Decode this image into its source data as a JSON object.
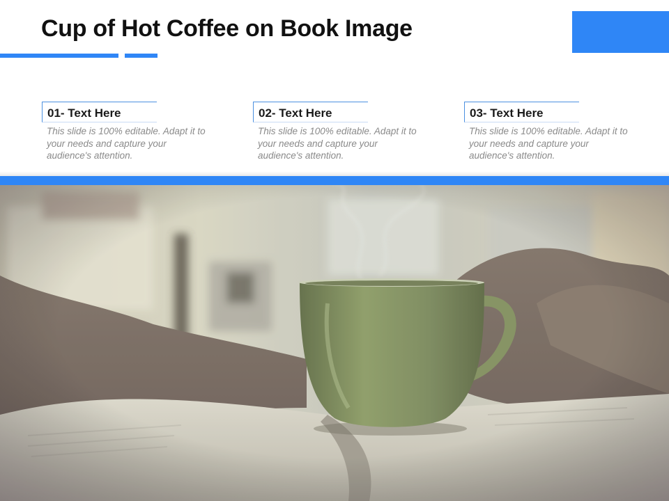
{
  "slide": {
    "title": "Cup of Hot Coffee on Book Image",
    "accent_color": "#2f86f6"
  },
  "cards": [
    {
      "heading": "01- Text Here",
      "description": "This slide is 100% editable. Adapt it to your needs and capture your audience's attention."
    },
    {
      "heading": "02- Text Here",
      "description": "This slide is 100% editable. Adapt it to your needs and capture your audience's attention."
    },
    {
      "heading": "03- Text Here",
      "description": "This slide is 100% editable. Adapt it to your needs and capture your audience's attention."
    }
  ],
  "photo": {
    "subject": "steaming green coffee cup on open book with blanket"
  }
}
